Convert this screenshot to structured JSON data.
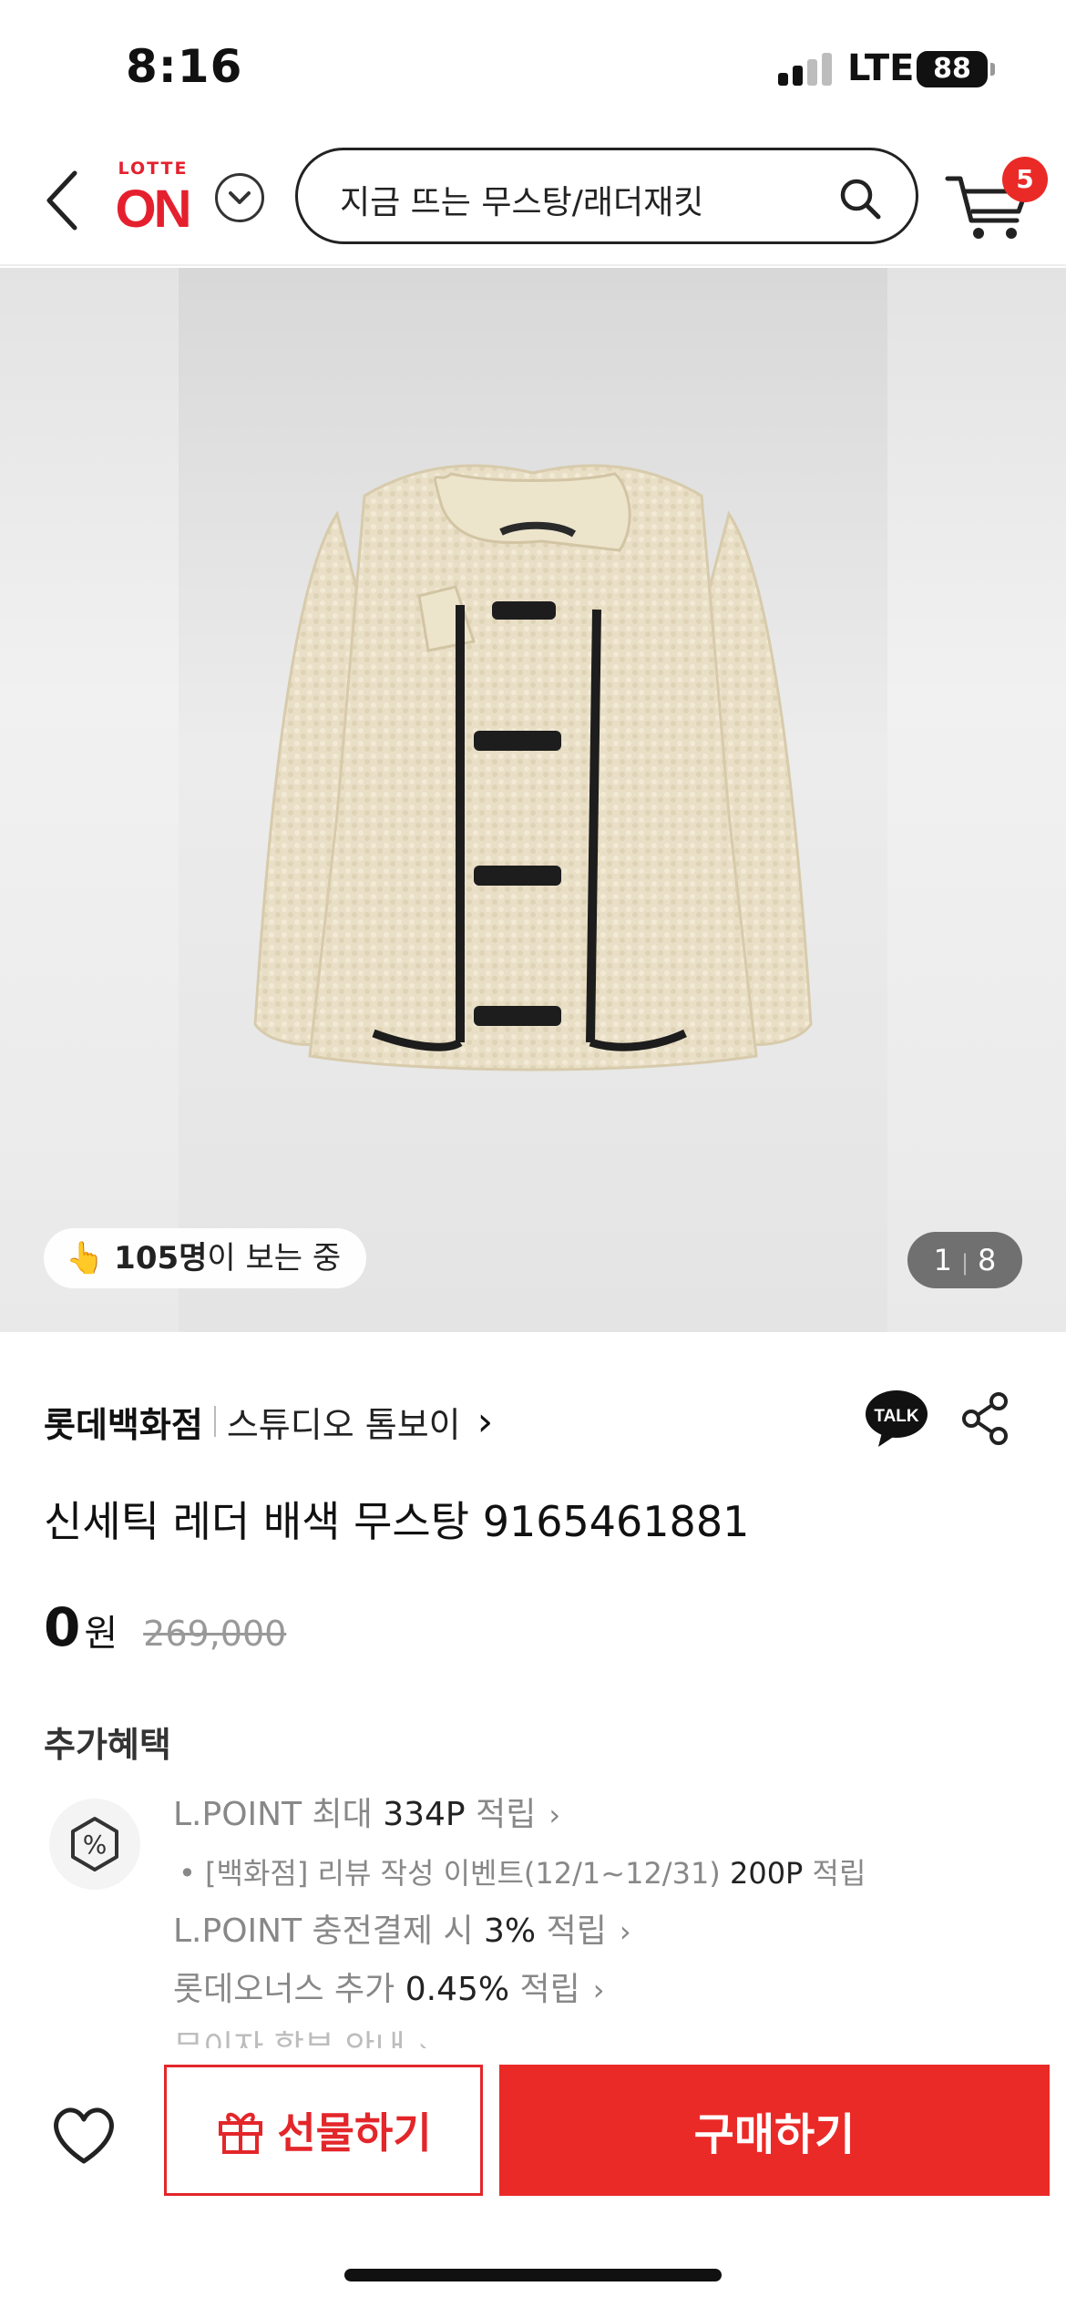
{
  "status_bar": {
    "time": "8:16",
    "network": "LTE",
    "battery": "88"
  },
  "header": {
    "logo_top": "LOTTE",
    "logo_main": "ON",
    "search_text": "지금 뜨는 무스탕/래더재킷",
    "cart_count": "5"
  },
  "hero": {
    "viewer_count": "105명",
    "viewer_suffix": "이 보는 중",
    "page_current": "1",
    "page_total": "8"
  },
  "product": {
    "brand": "롯데백화점",
    "shop": "스튜디오 톰보이",
    "shop_arrow": "›",
    "talk_label": "TALK",
    "title": "신세틱 레더 배색 무스탕 9165461881",
    "price": "0",
    "price_unit": "원",
    "original_price": "269,000"
  },
  "benefits": {
    "title": "추가혜택",
    "items": [
      {
        "prefix": "L.POINT 최대 ",
        "highlight": "334P",
        "suffix": " 적립",
        "arrow": "›"
      },
      {
        "prefix": "• [백화점] 리뷰 작성 이벤트(12/1~12/31) ",
        "highlight": "200P",
        "suffix": " 적립",
        "arrow": ""
      },
      {
        "prefix": "L.POINT 충전결제 시 ",
        "highlight": "3%",
        "suffix": " 적립",
        "arrow": "›"
      },
      {
        "prefix": "롯데오너스 추가 ",
        "highlight": "0.45%",
        "suffix": " 적립",
        "arrow": "›"
      },
      {
        "prefix": "무이자 할부 안내",
        "highlight": "",
        "suffix": "",
        "arrow": "›"
      }
    ]
  },
  "bottom": {
    "gift_label": "선물하기",
    "buy_label": "구매하기"
  },
  "colors": {
    "brand_red": "#e5202e",
    "buy_red": "#ea2a27",
    "coat_cream": "#eae0c8",
    "trim_black": "#1d1d1d"
  }
}
